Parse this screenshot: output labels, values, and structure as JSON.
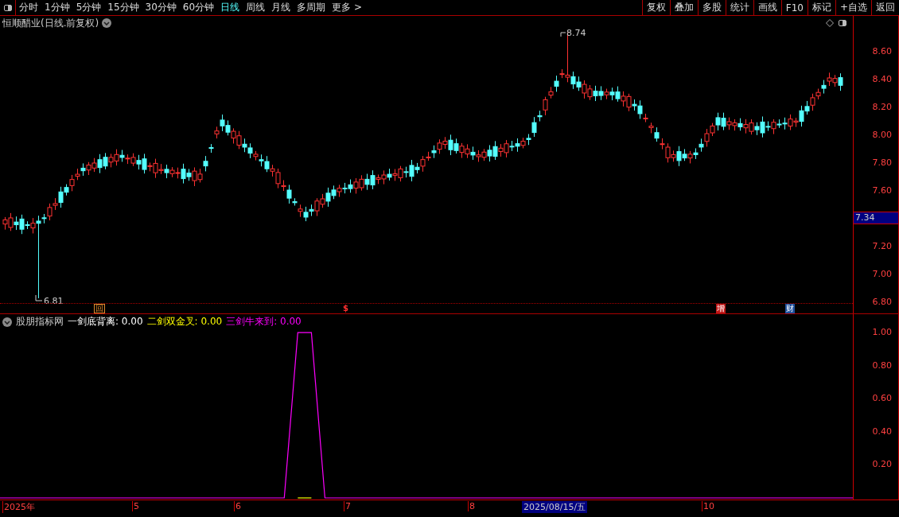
{
  "toolbar": {
    "periods": [
      {
        "label": "分时",
        "selected": false
      },
      {
        "label": "1分钟",
        "selected": false
      },
      {
        "label": "5分钟",
        "selected": false
      },
      {
        "label": "15分钟",
        "selected": false
      },
      {
        "label": "30分钟",
        "selected": false
      },
      {
        "label": "60分钟",
        "selected": false
      },
      {
        "label": "日线",
        "selected": true
      },
      {
        "label": "周线",
        "selected": false
      },
      {
        "label": "月线",
        "selected": false
      },
      {
        "label": "多周期",
        "selected": false
      },
      {
        "label": "更多 >",
        "selected": false
      }
    ],
    "actions": [
      "复权",
      "叠加",
      "多股",
      "统计",
      "画线",
      "F10",
      "标记",
      "+自选",
      "返回"
    ]
  },
  "main_chart": {
    "title": "恒顺醋业(日线.前复权)",
    "high_label": "8.74",
    "low_label": "6.81",
    "price_ticks": [
      "8.60",
      "8.40",
      "8.20",
      "8.00",
      "7.80",
      "7.60",
      "7.20",
      "7.00",
      "6.80"
    ],
    "current_price": "7.34",
    "event_markers": [
      {
        "label": "回",
        "kind": "box",
        "color": "#e08a2c"
      },
      {
        "label": "$",
        "kind": "text",
        "color": "#ff3030"
      },
      {
        "label": "增",
        "kind": "tag",
        "color": "#c01818"
      },
      {
        "label": "财",
        "kind": "tag",
        "color": "#1e4f9c"
      }
    ]
  },
  "indicator": {
    "name": "股朋指标网",
    "readings": [
      "0.00",
      "0.00",
      "0.00"
    ],
    "chart_data": {
      "type": "line",
      "ylim": [
        0,
        1.02
      ],
      "yticks": [
        {
          "value": 0.2,
          "label": "0.20"
        },
        {
          "value": 0.4,
          "label": "0.40"
        },
        {
          "value": 0.6,
          "label": "0.60"
        },
        {
          "value": 0.8,
          "label": "0.80"
        },
        {
          "value": 1.0,
          "label": "1.00"
        }
      ],
      "series": [
        {
          "name": "一剑底背离:",
          "color": "#ffffff",
          "values": [
            null,
            null,
            null,
            null,
            null,
            null,
            null,
            null,
            null,
            null,
            null,
            null,
            null,
            null,
            null,
            null,
            null,
            null,
            null,
            null,
            null,
            null,
            null,
            null,
            null,
            null,
            null,
            null,
            null,
            null,
            null,
            null,
            null,
            null,
            null,
            null,
            null,
            null,
            null,
            null,
            null,
            null,
            null,
            null,
            null,
            null,
            null,
            null,
            null,
            null,
            null,
            null,
            null,
            null,
            null,
            null,
            null,
            null,
            null,
            null,
            null,
            null,
            null,
            null
          ]
        },
        {
          "name": "二剑双金叉:",
          "color": "#ffff00",
          "values": [
            null,
            null,
            null,
            null,
            null,
            null,
            null,
            null,
            null,
            null,
            null,
            null,
            null,
            null,
            null,
            null,
            null,
            null,
            null,
            null,
            null,
            null,
            0,
            0,
            null,
            null,
            null,
            null,
            null,
            null,
            null,
            null,
            null,
            null,
            null,
            null,
            null,
            null,
            null,
            null,
            null,
            null,
            null,
            null,
            null,
            null,
            null,
            null,
            null,
            null,
            null,
            null,
            null,
            null,
            null,
            null,
            null,
            null,
            null,
            null,
            null,
            null,
            null,
            null
          ]
        },
        {
          "name": "三剑牛来到:",
          "color": "#ff00ff",
          "values": [
            0,
            0,
            0,
            0,
            0,
            0,
            0,
            0,
            0,
            0,
            0,
            0,
            0,
            0,
            0,
            0,
            0,
            0,
            0,
            0,
            0,
            0,
            1,
            1,
            0,
            0,
            0,
            0,
            0,
            0,
            0,
            0,
            0,
            0,
            0,
            0,
            0,
            0,
            0,
            0,
            0,
            0,
            0,
            0,
            0,
            0,
            0,
            0,
            0,
            0,
            0,
            0,
            0,
            0,
            0,
            0,
            0,
            0,
            0,
            0,
            0,
            0,
            0,
            0
          ]
        }
      ]
    }
  },
  "time_axis": {
    "labels": [
      "2025年",
      "5",
      "6",
      "7",
      "8",
      "10"
    ],
    "cursor_date": "2025/08/15/五"
  }
}
